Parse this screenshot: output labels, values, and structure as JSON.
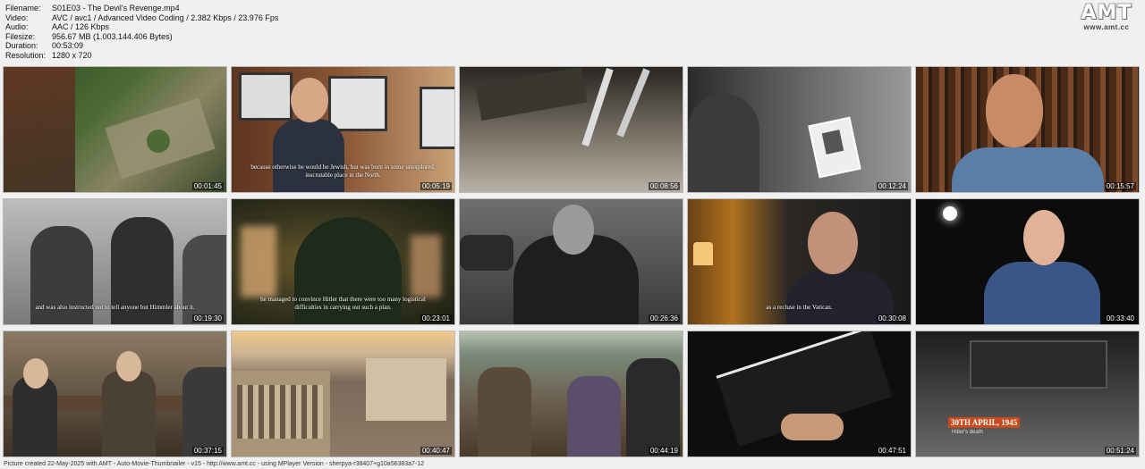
{
  "info": {
    "filename_label": "Filename:",
    "filename": "S01E03 - The Devil's Revenge.mp4",
    "video_label": "Video:",
    "video": "AVC / avc1 / Advanced Video Coding / 2.382 Kbps / 23.976 Fps",
    "audio_label": "Audio:",
    "audio": "AAC / 126 Kbps",
    "filesize_label": "Filesize:",
    "filesize": "956.67 MB (1.003.144.406 Bytes)",
    "duration_label": "Duration:",
    "duration": "00:53:09",
    "resolution_label": "Resolution:",
    "resolution": "1280 x 720"
  },
  "logo": {
    "main": "AMT",
    "url": "www.amt.cc"
  },
  "thumbnails": [
    {
      "time": "00:01:45",
      "subtitle": ""
    },
    {
      "time": "00:05:19",
      "subtitle": "because otherwise he would be Jewish, but was born in some unexplored, inscrutable place in the North."
    },
    {
      "time": "00:08:56",
      "subtitle": ""
    },
    {
      "time": "00:12:24",
      "subtitle": ""
    },
    {
      "time": "00:15:57",
      "subtitle": ""
    },
    {
      "time": "00:19:30",
      "subtitle": "and was also instructed not to tell anyone but Himmler about it."
    },
    {
      "time": "00:23:01",
      "subtitle": "he managed to convince Hitler that there were too many logistical difficulties in carrying out such a plan."
    },
    {
      "time": "00:26:36",
      "subtitle": ""
    },
    {
      "time": "00:30:08",
      "subtitle": "as a recluse in the Vatican."
    },
    {
      "time": "00:33:40",
      "subtitle": ""
    },
    {
      "time": "00:37:15",
      "subtitle": ""
    },
    {
      "time": "00:40:47",
      "subtitle": ""
    },
    {
      "time": "00:44:19",
      "subtitle": ""
    },
    {
      "time": "00:47:51",
      "subtitle": ""
    },
    {
      "time": "00:51:24",
      "subtitle": ""
    }
  ],
  "caption_14": {
    "date": "30TH APRIL, 1945",
    "place": "Hitler's death"
  },
  "footer": "Picture created 22-May-2025 with AMT - Auto-Movie-Thumbnailer - v15 - http://www.amt.cc - using MPlayer Version - sherpya-r38407+g10a56383a7-12"
}
